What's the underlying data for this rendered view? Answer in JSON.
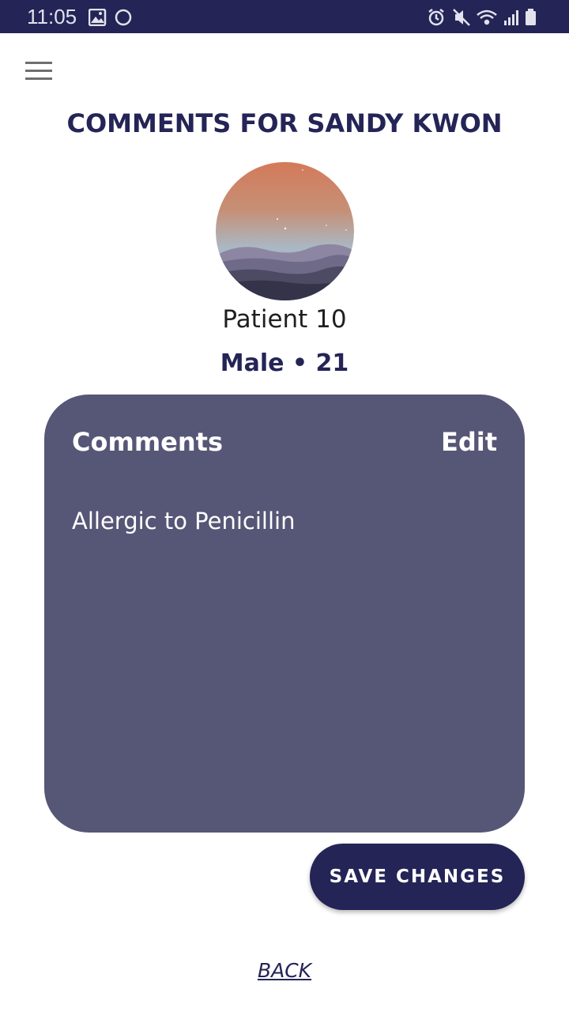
{
  "status_bar": {
    "time": "11:05",
    "left_icons": [
      "image-icon",
      "circle-icon"
    ],
    "right_icons": [
      "alarm-icon",
      "mute-icon",
      "wifi-icon",
      "signal-icon",
      "battery-icon"
    ]
  },
  "header": {
    "menu_icon": "hamburger-menu-icon",
    "title": "COMMENTS FOR SANDY KWON"
  },
  "patient": {
    "name": "Patient 10",
    "meta": "Male • 21"
  },
  "comments": {
    "heading": "Comments",
    "edit_label": "Edit",
    "text": "Allergic to Penicillin"
  },
  "actions": {
    "save_label": "SAVE CHANGES",
    "back_label": "BACK"
  },
  "colors": {
    "primary": "#242457",
    "card": "#565676",
    "text_dark": "#1f1f1f",
    "white": "#ffffff"
  }
}
